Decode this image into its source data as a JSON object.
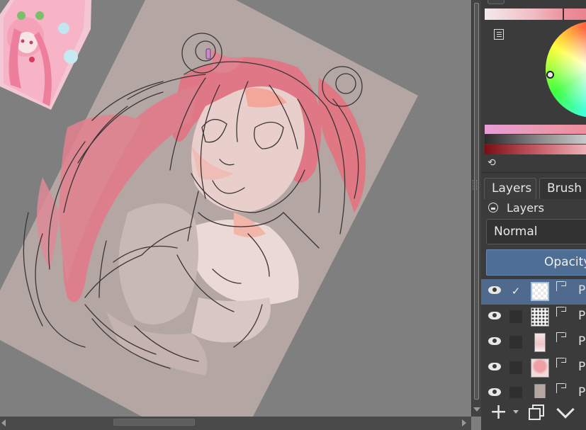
{
  "canvas": {
    "background_color": "#7f7f7f",
    "paper_color": "#b3a6a3"
  },
  "dock": {
    "tabs": [
      "Layers",
      "Brush I"
    ],
    "layers_panel_title": "Layers",
    "blend_mode": "Normal",
    "opacity_label": "Opacity",
    "selected_color": "#f0e8e8",
    "layers": [
      {
        "name": "P",
        "visible": true,
        "selected": true,
        "checked": true
      },
      {
        "name": "P",
        "visible": true,
        "selected": false,
        "checked": false
      },
      {
        "name": "P",
        "visible": true,
        "selected": false,
        "checked": false
      },
      {
        "name": "P",
        "visible": true,
        "selected": false,
        "checked": false
      },
      {
        "name": "P",
        "visible": true,
        "selected": false,
        "checked": false
      }
    ],
    "icons": {
      "check": "✓",
      "refresh": "⟲",
      "add": "+"
    }
  }
}
